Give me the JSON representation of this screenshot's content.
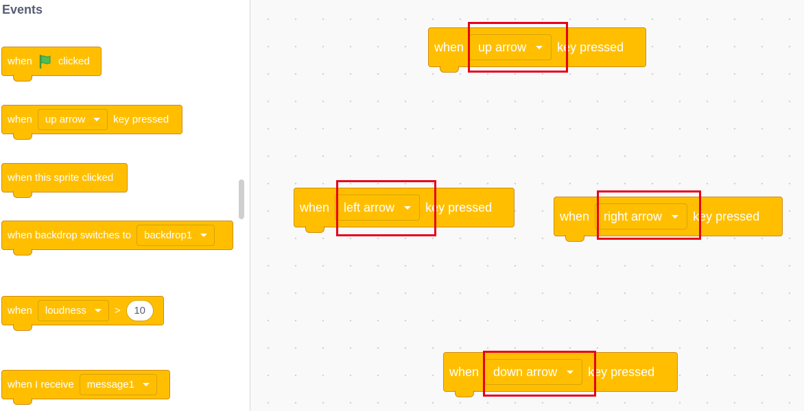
{
  "palette": {
    "title": "Events",
    "blocks": {
      "flag": {
        "when": "when",
        "clicked": "clicked"
      },
      "key": {
        "when": "when",
        "key": "up arrow",
        "suffix": "key pressed"
      },
      "sprite": {
        "label": "when this sprite clicked"
      },
      "backdrop": {
        "label": "when backdrop switches to",
        "value": "backdrop1"
      },
      "loudness": {
        "when": "when",
        "sensor": "loudness",
        "op": ">",
        "value": "10"
      },
      "receive": {
        "label": "when I receive",
        "value": "message1"
      }
    }
  },
  "workspace": {
    "blocks": [
      {
        "when": "when",
        "key": "up arrow",
        "suffix": "key pressed"
      },
      {
        "when": "when",
        "key": "left arrow",
        "suffix": "key pressed"
      },
      {
        "when": "when",
        "key": "right arrow",
        "suffix": "key pressed"
      },
      {
        "when": "when",
        "key": "down arrow",
        "suffix": "key pressed"
      }
    ]
  },
  "colors": {
    "events_block": "#ffbf00",
    "block_border": "#cf8b17",
    "highlight": "#e60019",
    "palette_title": "#575e75",
    "flag": "#4cbf56"
  },
  "icons": {
    "green_flag": "green-flag-icon",
    "dropdown": "caret-down-icon"
  }
}
